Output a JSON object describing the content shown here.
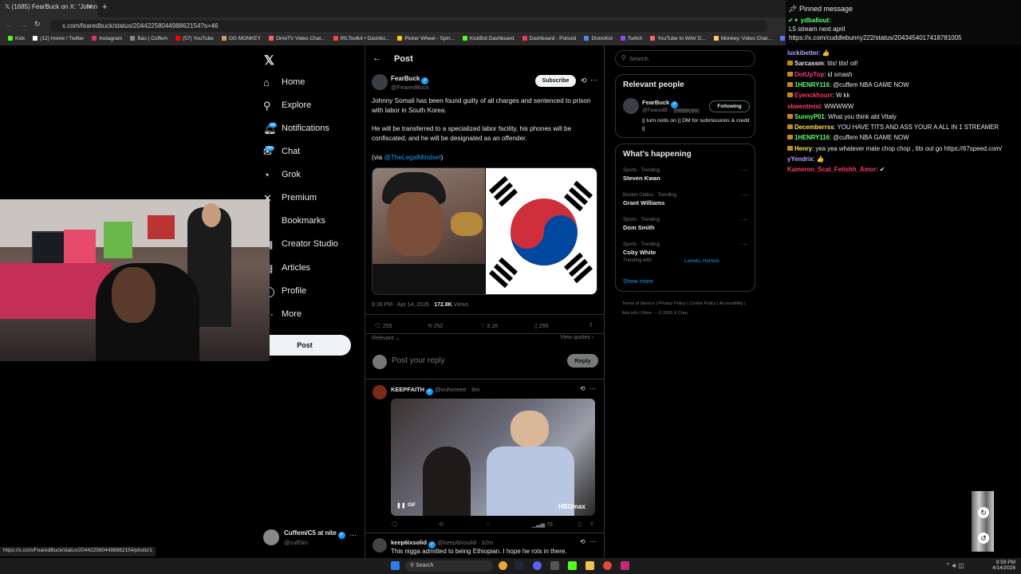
{
  "browser": {
    "tab_title": "(1685) FearBuck on X: \"Johnny",
    "tab_close": "✕",
    "new_tab": "+",
    "url": "x.com/fearedbuck/status/2044225804498862154?s=46",
    "bookmarks": [
      {
        "label": "Kick",
        "color": "#53fc18"
      },
      {
        "label": "(12) Home / Twitter",
        "color": "#ffffff"
      },
      {
        "label": "Instagram",
        "color": "#e1306c"
      },
      {
        "label": "Bau | Cuffem",
        "color": "#888888"
      },
      {
        "label": "(57) YouTube",
        "color": "#ff0000"
      },
      {
        "label": "OG MONKEY",
        "color": "#c8a060"
      },
      {
        "label": "OmeTV Video Chat...",
        "color": "#ff6060"
      },
      {
        "label": "IRLToolkit • Dashbo...",
        "color": "#ff4444"
      },
      {
        "label": "Picker Wheel - Spin...",
        "color": "#ffcc00"
      },
      {
        "label": "KickBot Dashboard",
        "color": "#53fc18"
      },
      {
        "label": "Dashboard - Pulsoid",
        "color": "#ff3355"
      },
      {
        "label": "DistroKid",
        "color": "#4a90e2"
      },
      {
        "label": "Twitch",
        "color": "#9146ff"
      },
      {
        "label": "YouTube to WAV D...",
        "color": "#ff6666"
      },
      {
        "label": "Monkey: Video Chat...",
        "color": "#ffcc66"
      },
      {
        "label": "Home - Rob",
        "color": "#5577ff"
      }
    ],
    "status_url": "https://x.com/FearedBuck/status/2044225804498862154/photo/1"
  },
  "x_nav": {
    "items": [
      {
        "label": "Home",
        "icon": "⌂"
      },
      {
        "label": "Explore",
        "icon": "⚲"
      },
      {
        "label": "Notifications",
        "icon": "🔔︎"
      },
      {
        "label": "Chat",
        "icon": "✉"
      },
      {
        "label": "Grok",
        "icon": "◔"
      },
      {
        "label": "Premium",
        "icon": "✕"
      },
      {
        "label": "Bookmarks",
        "icon": "▯"
      },
      {
        "label": "Creator Studio",
        "icon": "▦"
      },
      {
        "label": "Articles",
        "icon": "▤"
      },
      {
        "label": "Profile",
        "icon": "◯"
      },
      {
        "label": "More",
        "icon": "⋯"
      }
    ],
    "notifications_badge": "99",
    "chat_badge": "20+",
    "post_button": "Post",
    "account_name": "Cuffem/C5 at nite",
    "account_handle": "@cuff3m"
  },
  "post": {
    "header": "Post",
    "author_name": "FearBuck",
    "author_handle": "@FearedBuck",
    "subscribe": "Subscribe",
    "paragraph1": "Johnny Somali has been found guilty of all charges and sentenced to prison with labor in South Korea.",
    "paragraph2": "He will be transferred to a specialized labor facility, his phones will be confiscated, and he will be designated as an offender.",
    "via_prefix": "(via ",
    "via_handle": "@TheLegalMindset",
    "via_suffix": ")",
    "timestamp": "9:26 PM · Apr 14, 2026 · ",
    "views_count": "172.8K",
    "views_label": " Views",
    "replies": "255",
    "reposts": "252",
    "likes": "3.1K",
    "bookmarks": "295",
    "relevant": "Relevant",
    "view_quotes": "View quotes",
    "reply_placeholder": "Post your reply",
    "reply_button": "Reply"
  },
  "replies": [
    {
      "name": "KEEPFAITH",
      "handle": "@ouhereee · 9m",
      "gif_label": "GIF",
      "watermark": "HBOmax",
      "views": "76"
    },
    {
      "name": "keep6ixsolid",
      "handle": "@keep6ixsolid · 32m",
      "text": "This nigga admitted to being Ethiopian. I hope he rots in there."
    }
  ],
  "sidebar": {
    "search_placeholder": "Search",
    "relevant_title": "Relevant people",
    "person_name": "FearBuck",
    "person_handle": "@FearedB...",
    "follows_you": "Follows you",
    "following": "Following",
    "person_bio": "|| turn notis on || DM for submissions & credit ||",
    "happening_title": "What's happening",
    "trends": [
      {
        "category": "Sports · Trending",
        "name": "Steven Kwan",
        "extra": ""
      },
      {
        "category": "Boston Celtics · Trending",
        "name": "Grant Williams",
        "extra": ""
      },
      {
        "category": "Sports · Trending",
        "name": "Dom Smith",
        "extra": ""
      },
      {
        "category": "Sports · Trending",
        "name": "Coby White",
        "extra": "Trending with "
      }
    ],
    "trend_links": "Lamelo, Hornets",
    "show_more": "Show more",
    "footer_links": [
      "Terms of Service",
      "Privacy Policy",
      "Cookie Policy",
      "Accessibility",
      "Ads info",
      "More ···",
      "© 2026 X Corp."
    ]
  },
  "chat": {
    "pinned_label": "Pinned message",
    "pinned_user": "ydballout:",
    "pinned_text": "L5 stream next april",
    "pinned_link": "https://x.com/cuddlebunny222/status/2043454017418781005",
    "messages": [
      {
        "user": "luckibetter",
        "color": "#b6a4ff",
        "text": "👍",
        "icon": false
      },
      {
        "user": "Sarcassm",
        "color": "#e7e9ea",
        "text": "tits! tits! oil!",
        "icon": true
      },
      {
        "user": "DotUpTop",
        "color": "#ff3b8e",
        "text": "id smash",
        "icon": true
      },
      {
        "user": "1HENRY116",
        "color": "#5cff72",
        "text": "@cuffem NBA GAME NOW",
        "icon": true
      },
      {
        "user": "Eyenckhourr",
        "color": "#ff3b6b",
        "text": "W kk",
        "icon": true
      },
      {
        "user": "skwentmisi",
        "color": "#ff3b6b",
        "text": "WWWWW",
        "icon": false
      },
      {
        "user": "SunnyP01",
        "color": "#5cff72",
        "text": "What you think abt Vitaly",
        "icon": true
      },
      {
        "user": "Decemberrss",
        "color": "#ffe14d",
        "text": "YOU HAVE TITS AND ASS YOUR A ALL IN 1 STREAMER",
        "icon": true
      },
      {
        "user": "1HENRY116",
        "color": "#5cff72",
        "text": "@cuffem NBA GAME NOW",
        "icon": true
      },
      {
        "user": "Henry",
        "color": "#ffe14d",
        "text": "yea yea whatever mate chop chop , tits out go https://67speed.com/",
        "icon": true
      },
      {
        "user": "yYendrix",
        "color": "#b6a4ff",
        "text": "👍",
        "icon": false
      },
      {
        "user": "Kameron_Scat_Fetishh_Amor",
        "color": "#ff3b6b",
        "text": "✔",
        "icon": false
      }
    ]
  },
  "taskbar": {
    "search": "Search",
    "time": "9:59 PM",
    "date": "4/14/2026"
  }
}
